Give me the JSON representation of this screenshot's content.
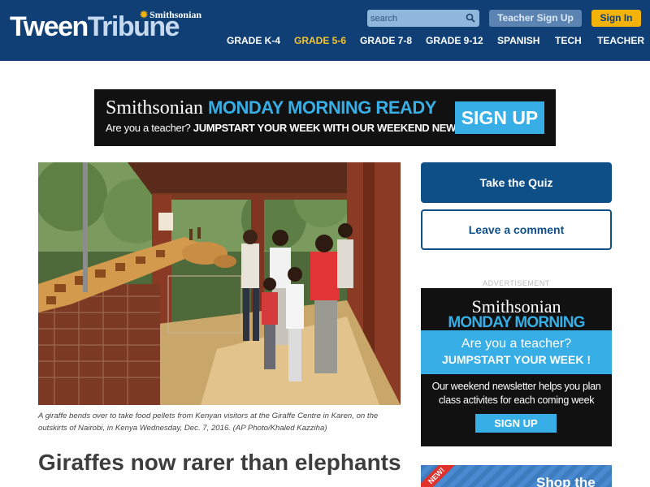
{
  "header": {
    "logo_tween": "Tween",
    "logo_tribune": "Tribune",
    "logo_smithsonian": "Smithsonian",
    "search_placeholder": "search",
    "teacher_signup_label": "Teacher Sign Up",
    "signin_label": "Sign In",
    "nav": [
      {
        "label": "GRADE K-4",
        "active": false
      },
      {
        "label": "GRADE 5-6",
        "active": true
      },
      {
        "label": "GRADE 7-8",
        "active": false
      },
      {
        "label": "GRADE 9-12",
        "active": false
      },
      {
        "label": "SPANISH",
        "active": false
      },
      {
        "label": "TECH",
        "active": false
      },
      {
        "label": "TEACHER",
        "active": false
      }
    ],
    "colors": {
      "bar": "#0f3f75",
      "active_nav": "#f3c531",
      "signin": "#f3b30a"
    }
  },
  "banner_ad": {
    "brand": "Smithsonian",
    "title": "MONDAY MORNING READY",
    "question": "Are you a teacher?",
    "tagline": "JUMPSTART YOUR WEEK WITH OUR WEEKEND NEWSLETTER!",
    "button_label": "SIGN UP"
  },
  "article": {
    "image_alt": "A giraffe bends over to take food pellets from Kenyan visitors",
    "caption": "A giraffe bends over to take food pellets from Kenyan visitors at the Giraffe Centre in Karen, on the outskirts of Nairobi, in Kenya Wednesday, Dec. 7, 2016. (AP Photo/Khaled Kazziha)",
    "headline": "Giraffes now rarer than elephants"
  },
  "sidebar": {
    "quiz_label": "Take the Quiz",
    "comment_label": "Leave a comment",
    "ad_label": "ADVERTISEMENT",
    "square_ad": {
      "brand": "Smithsonian",
      "title": "MONDAY MORNING READY",
      "question": "Are you a teacher?",
      "tagline": "JUMPSTART YOUR WEEK !",
      "body": "Our weekend newsletter helps you plan class activites for each coming week",
      "button_label": "SIGN UP"
    },
    "shop": {
      "badge": "NEW!",
      "label": "Shop the"
    },
    "colors": {
      "primary": "#0f4f87",
      "accent": "#37aee5"
    }
  }
}
